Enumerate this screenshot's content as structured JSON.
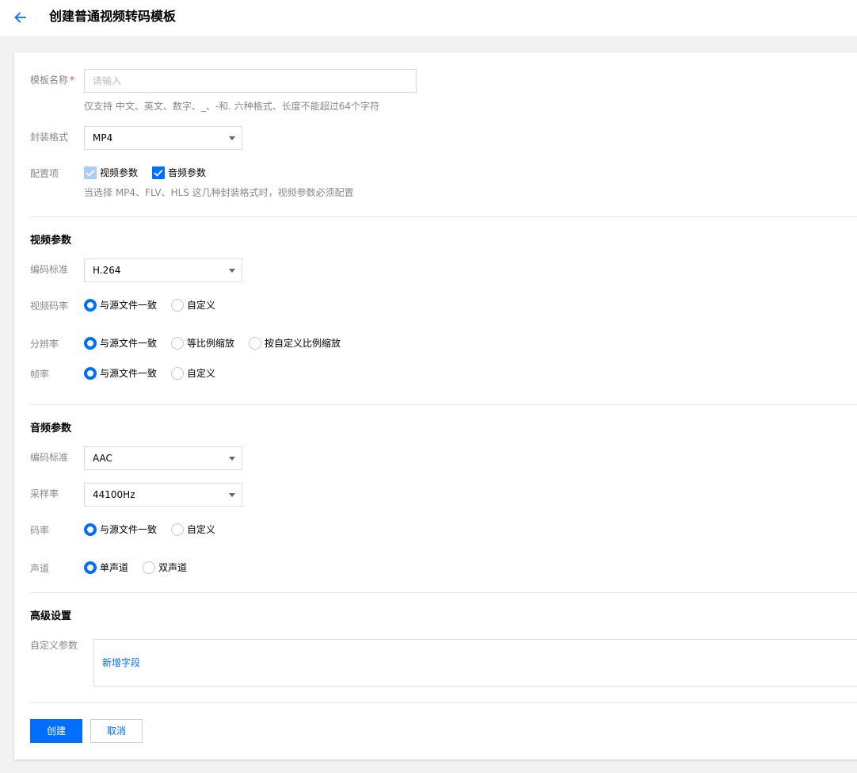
{
  "header": {
    "title": "创建普通视频转码模板"
  },
  "basic": {
    "name_label": "模板名称",
    "required_mark": "*",
    "name_placeholder": "请输入",
    "name_value": "",
    "name_hint": "仅支持 中文、英文、数字、_、-和. 六种格式、长度不能超过64个字符",
    "format_label": "封装格式",
    "format_value": "MP4",
    "config_label": "配置项",
    "config_options": [
      {
        "label": "视频参数",
        "checked": true,
        "disabled": true
      },
      {
        "label": "音频参数",
        "checked": true,
        "disabled": false
      }
    ],
    "config_hint": "当选择 MP4、FLV、HLS 这几种封装格式时，视频参数必须配置"
  },
  "video": {
    "section_title": "视频参数",
    "codec_label": "编码标准",
    "codec_value": "H.264",
    "bitrate_label": "视频码率",
    "bitrate_options": [
      "与源文件一致",
      "自定义"
    ],
    "resolution_label": "分辨率",
    "resolution_options": [
      "与源文件一致",
      "等比例缩放",
      "按自定义比例缩放"
    ],
    "framerate_label": "帧率",
    "framerate_options": [
      "与源文件一致",
      "自定义"
    ]
  },
  "audio": {
    "section_title": "音频参数",
    "codec_label": "编码标准",
    "codec_value": "AAC",
    "samplerate_label": "采样率",
    "samplerate_value": "44100Hz",
    "bitrate_label": "码率",
    "bitrate_options": [
      "与源文件一致",
      "自定义"
    ],
    "channel_label": "声道",
    "channel_options": [
      "单声道",
      "双声道"
    ]
  },
  "advanced": {
    "section_title": "高级设置",
    "custom_label": "自定义参数",
    "add_field_link": "新增字段"
  },
  "footer": {
    "create_label": "创建",
    "cancel_label": "取消"
  },
  "colors": {
    "accent": "#006eff",
    "required": "#e54545",
    "label": "#888888",
    "page_bg": "#f2f2f2"
  }
}
